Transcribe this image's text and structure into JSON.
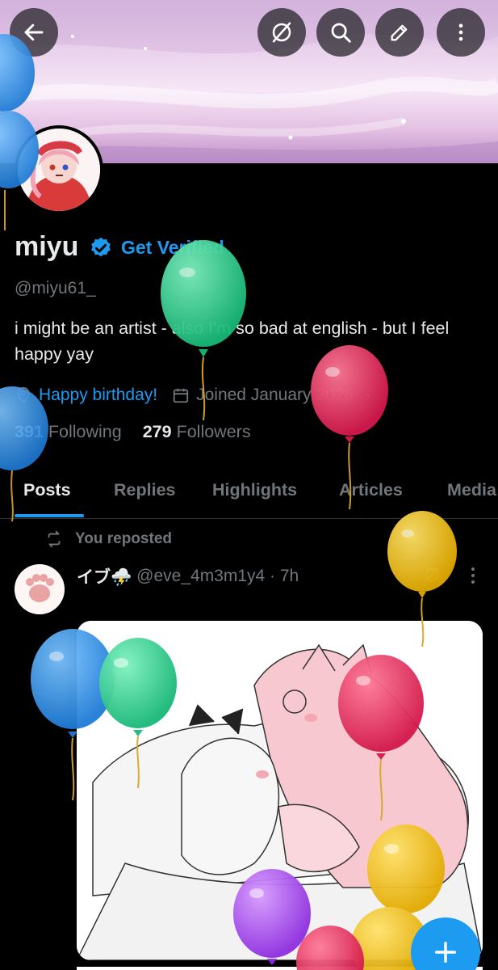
{
  "toolbar": {
    "back_icon": "arrow-left-icon",
    "icons": [
      "grok-off-icon",
      "search-icon",
      "edit-icon",
      "more-vertical-icon"
    ]
  },
  "profile": {
    "display_name": "miyu",
    "get_verified": "Get Verified",
    "handle": "@miyu61_",
    "bio": "i might be an artist - also I'm so bad at english - but I feel happy yay",
    "birthday_link": "Happy birthday!",
    "joined": "Joined January 2026",
    "following_count": "391",
    "following_label": "Following",
    "followers_count": "279",
    "followers_label": "Followers"
  },
  "tabs": [
    "Posts",
    "Replies",
    "Highlights",
    "Articles",
    "Media"
  ],
  "active_tab": "Posts",
  "post": {
    "repost_label": "You reposted",
    "author_name": "イブ⛈️",
    "author_handle": "@eve_4m3m1y4 · 7h"
  },
  "fab_icon": "plus-icon",
  "colors": {
    "accent": "#1d9bf0",
    "background": "#000000",
    "text": "#e7e9ea",
    "muted": "#71767b"
  }
}
